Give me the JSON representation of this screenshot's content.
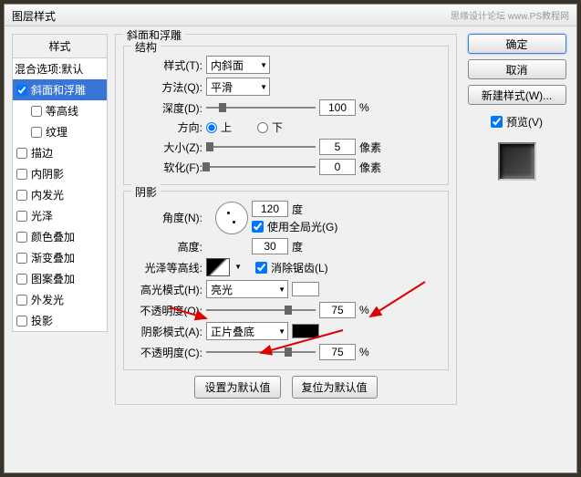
{
  "dialog_title": "图层样式",
  "watermark": "思缘设计论坛  www.PS教程网",
  "styles_panel": {
    "header": "样式",
    "blend_options": "混合选项:默认",
    "bevel_emboss": "斜面和浮雕",
    "contour": "等高线",
    "texture": "纹理",
    "stroke": "描边",
    "inner_shadow": "内阴影",
    "inner_glow": "内发光",
    "satin": "光泽",
    "color_overlay": "颜色叠加",
    "gradient_overlay": "渐变叠加",
    "pattern_overlay": "图案叠加",
    "outer_glow": "外发光",
    "drop_shadow": "投影"
  },
  "bevel": {
    "section_title": "斜面和浮雕",
    "structure_title": "结构",
    "style_label": "样式(T):",
    "style_value": "内斜面",
    "technique_label": "方法(Q):",
    "technique_value": "平滑",
    "depth_label": "深度(D):",
    "depth_value": "100",
    "direction_label": "方向:",
    "direction_up": "上",
    "direction_down": "下",
    "size_label": "大小(Z):",
    "size_value": "5",
    "size_unit": "像素",
    "soften_label": "软化(F):",
    "soften_value": "0",
    "soften_unit": "像素",
    "percent": "%"
  },
  "shading": {
    "section_title": "阴影",
    "angle_label": "角度(N):",
    "angle_value": "120",
    "angle_unit": "度",
    "global_light": "使用全局光(G)",
    "altitude_label": "高度:",
    "altitude_value": "30",
    "altitude_unit": "度",
    "gloss_contour_label": "光泽等高线:",
    "antialias": "消除锯齿(L)",
    "highlight_mode_label": "高光模式(H):",
    "highlight_mode_value": "亮光",
    "highlight_color": "#ffffff",
    "highlight_opacity_label": "不透明度(O):",
    "highlight_opacity_value": "75",
    "shadow_mode_label": "阴影模式(A):",
    "shadow_mode_value": "正片叠底",
    "shadow_color": "#000000",
    "shadow_opacity_label": "不透明度(C):",
    "shadow_opacity_value": "75"
  },
  "buttons": {
    "ok": "确定",
    "cancel": "取消",
    "new_style": "新建样式(W)...",
    "preview": "预览(V)",
    "make_default": "设置为默认值",
    "reset_default": "复位为默认值"
  }
}
